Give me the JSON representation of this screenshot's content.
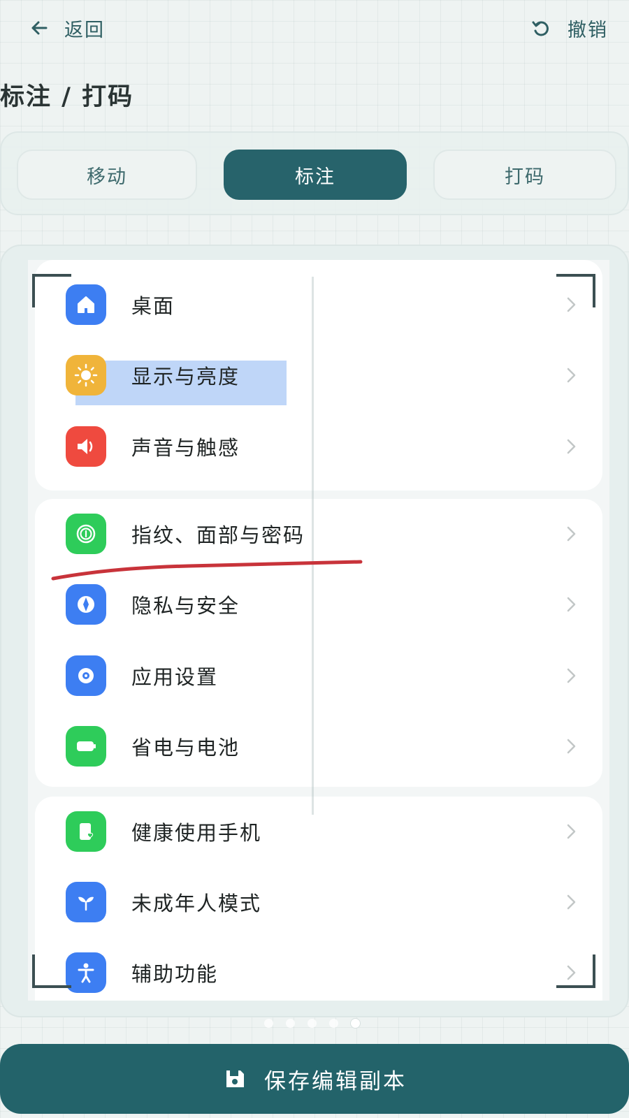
{
  "header": {
    "back_label": "返回",
    "undo_label": "撤销"
  },
  "page_title": "标注 / 打码",
  "tabs": {
    "move": "移动",
    "annotate": "标注",
    "mosaic": "打码",
    "selected": "标注"
  },
  "settings_list": {
    "group1": [
      {
        "label": "桌面",
        "icon": "home-icon",
        "color": "#3d7ef2"
      },
      {
        "label": "显示与亮度",
        "icon": "sun-icon",
        "color": "#f0b43a"
      },
      {
        "label": "声音与触感",
        "icon": "speaker-icon",
        "color": "#ef4a3f"
      }
    ],
    "group2": [
      {
        "label": "指纹、面部与密码",
        "icon": "fingerprint-icon",
        "color": "#2ecc5a"
      },
      {
        "label": "隐私与安全",
        "icon": "privacy-icon",
        "color": "#3d7ef2"
      },
      {
        "label": "应用设置",
        "icon": "app-settings-icon",
        "color": "#3d7ef2"
      },
      {
        "label": "省电与电池",
        "icon": "battery-icon",
        "color": "#2ecc5a"
      }
    ],
    "group3": [
      {
        "label": "健康使用手机",
        "icon": "wellbeing-icon",
        "color": "#2ecc5a"
      },
      {
        "label": "未成年人模式",
        "icon": "sprout-icon",
        "color": "#3d7ef2"
      },
      {
        "label": "辅助功能",
        "icon": "accessibility-icon",
        "color": "#3d7ef2"
      }
    ]
  },
  "annotations": {
    "highlight_color": "#aac8f5",
    "underline_color": "#c8333a"
  },
  "pagination": {
    "total": 5,
    "current": 5
  },
  "save_label": "保存编辑副本",
  "colors": {
    "accent": "#27636b",
    "background": "#eef3f2"
  }
}
